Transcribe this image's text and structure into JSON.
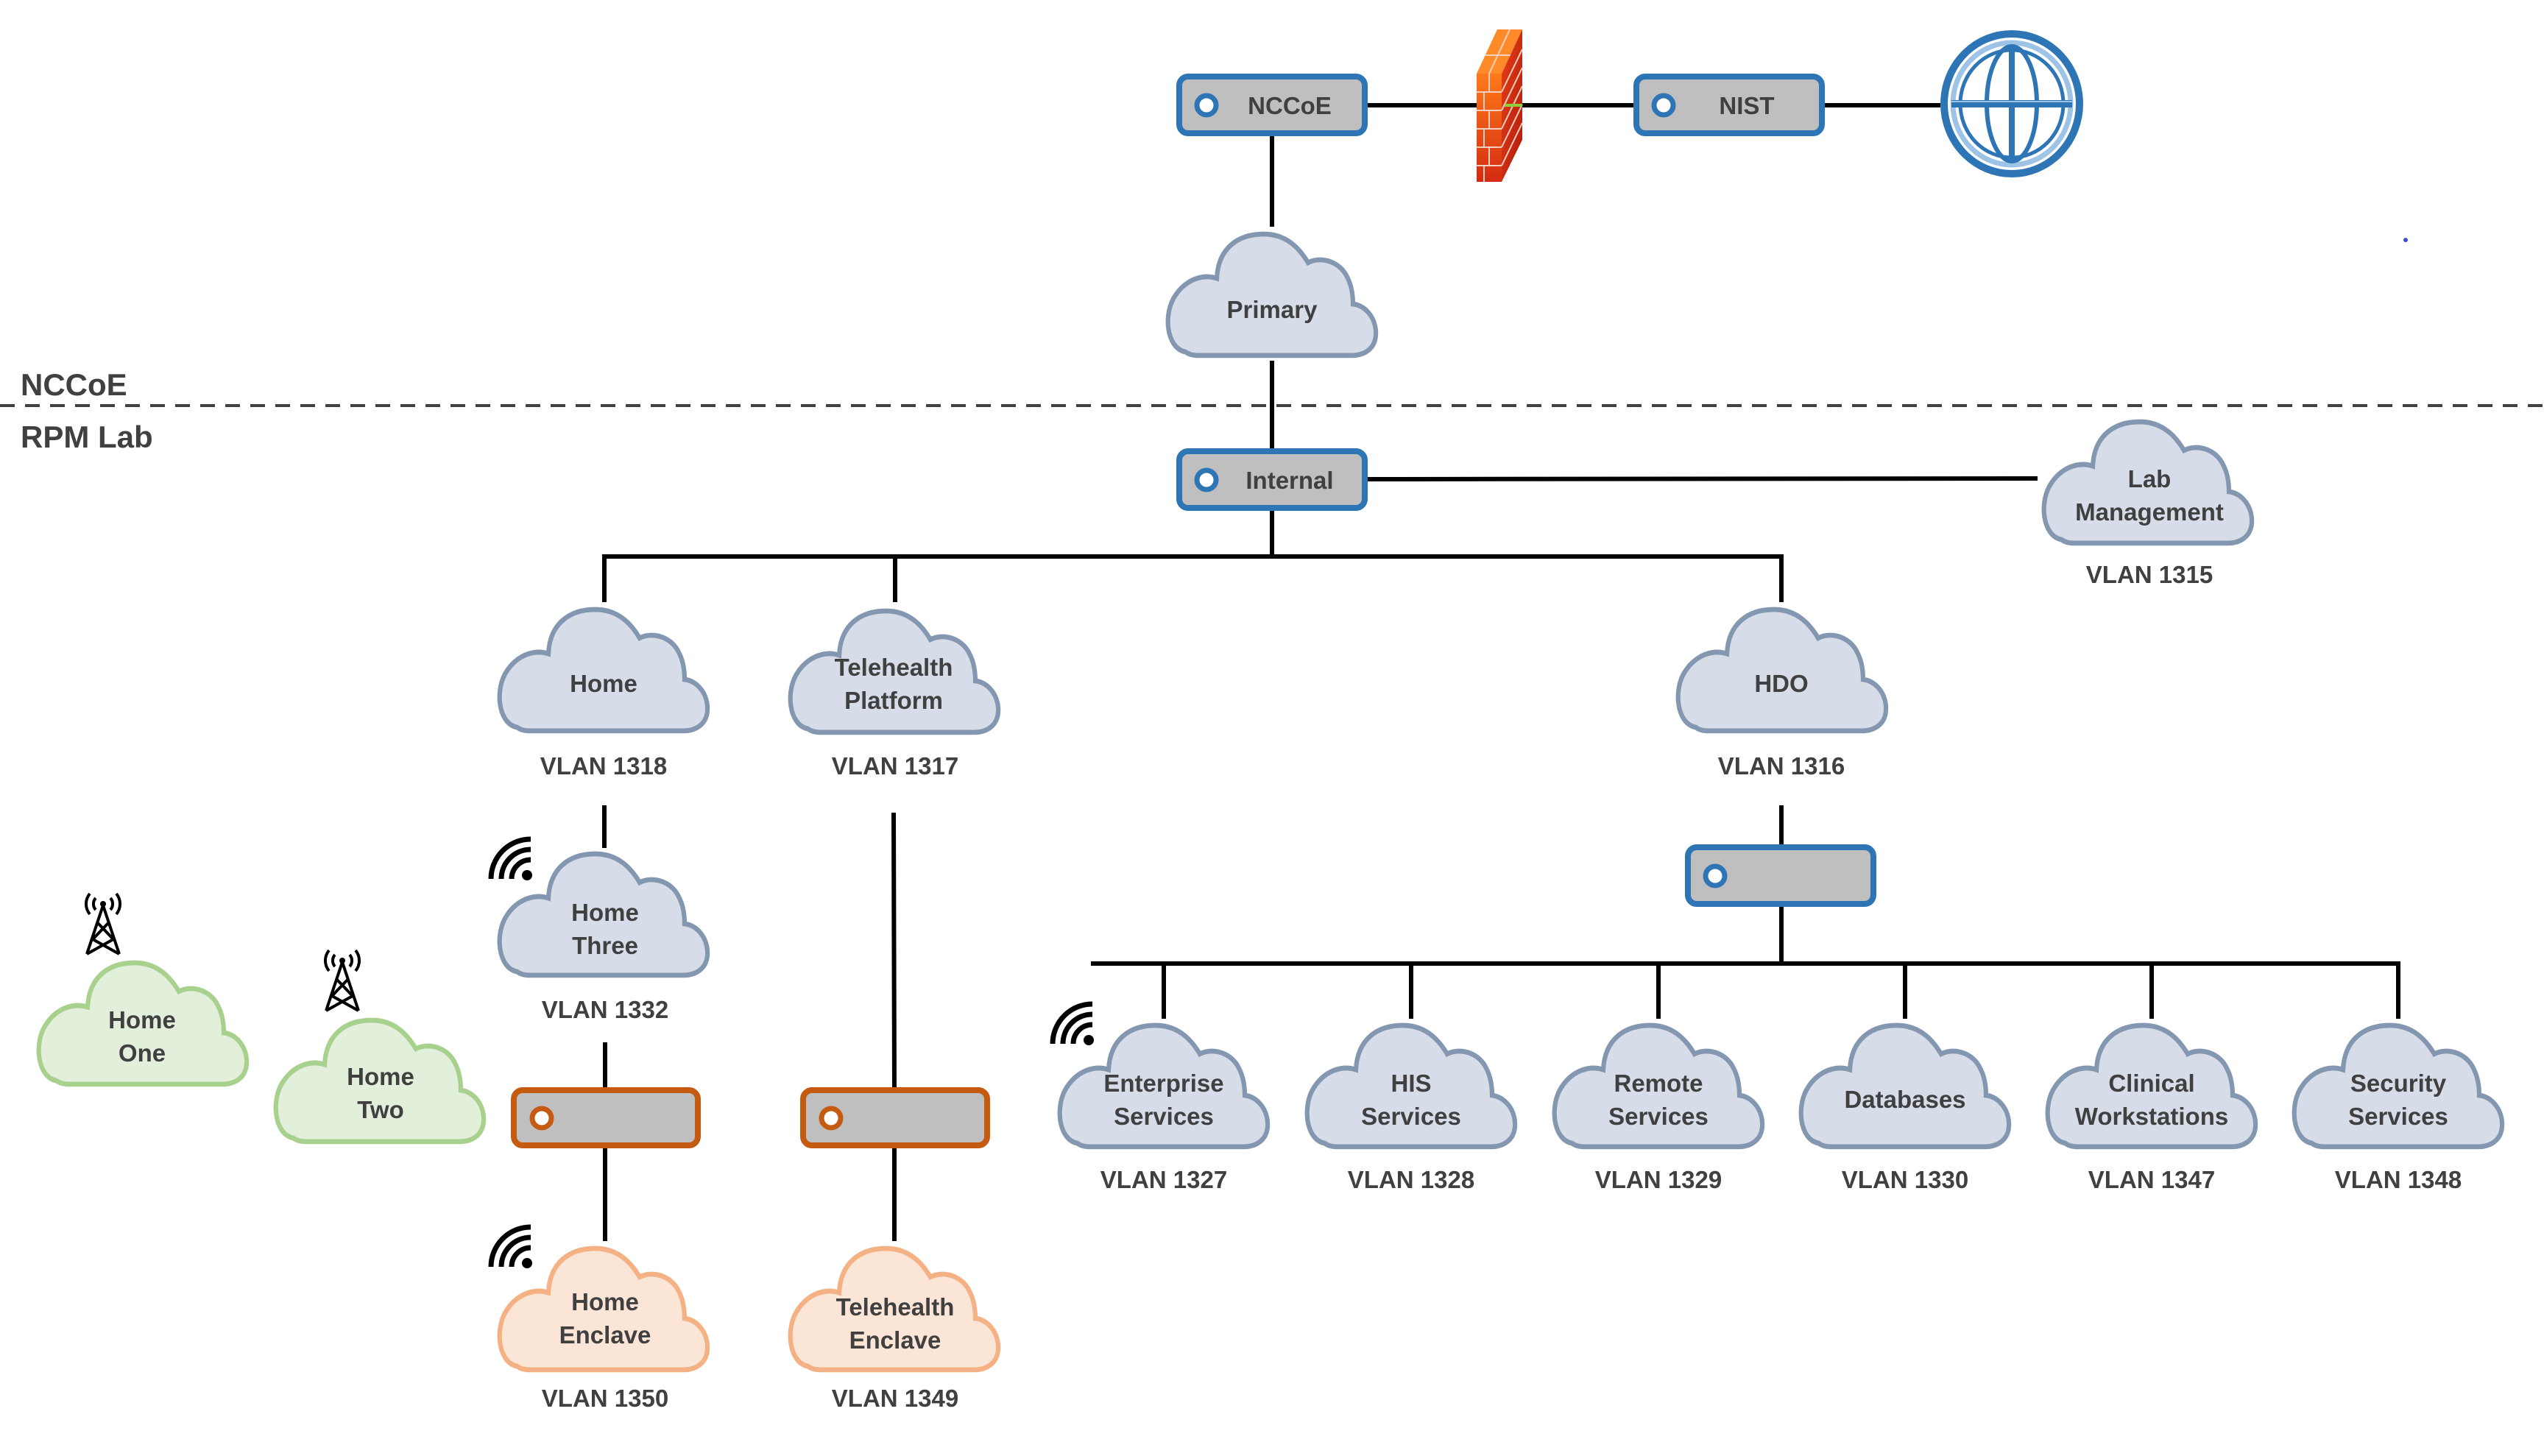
{
  "diagram": {
    "zones": {
      "upper_label": "NCCoE",
      "lower_label": "RPM Lab"
    },
    "colors": {
      "cloud_blue_fill": "#d6dde8",
      "cloud_blue_stroke": "#8497b0",
      "cloud_green_fill": "#e2efda",
      "cloud_green_stroke": "#a9d18e",
      "cloud_orange_fill": "#fbe5d6",
      "cloud_orange_stroke": "#f4b183",
      "router_fill": "#bfbfbf",
      "router_blue_stroke": "#2e75b6",
      "router_orange_stroke": "#c55a11",
      "line": "#000000",
      "text": "#404040",
      "globe": "#2e75b6",
      "globe_light": "#9dc3e6"
    },
    "top": {
      "nccoe_router": "NCCoE",
      "firewall": "firewall-icon",
      "nist_router": "NIST",
      "internet": "globe-icon",
      "primary_cloud": "Primary"
    },
    "internal_router": "Internal",
    "lab_management": {
      "line1": "Lab",
      "line2": "Management",
      "vlan": "VLAN 1315"
    },
    "home": {
      "label": "Home",
      "vlan": "VLAN 1318"
    },
    "telehealth_platform": {
      "line1": "Telehealth",
      "line2": "Platform",
      "vlan": "VLAN 1317"
    },
    "hdo": {
      "label": "HDO",
      "vlan": "VLAN 1316"
    },
    "home_three": {
      "line1": "Home",
      "line2": "Three",
      "vlan": "VLAN 1332",
      "icon": "wifi-icon"
    },
    "home_one": {
      "line1": "Home",
      "line2": "One",
      "icon": "cell-tower-icon"
    },
    "home_two": {
      "line1": "Home",
      "line2": "Two",
      "icon": "cell-tower-icon"
    },
    "home_enclave": {
      "line1": "Home",
      "line2": "Enclave",
      "vlan": "VLAN 1350",
      "icon": "wifi-icon"
    },
    "telehealth_enclave": {
      "line1": "Telehealth",
      "line2": "Enclave",
      "vlan": "VLAN 1349"
    },
    "hdo_subnets": [
      {
        "line1": "Enterprise",
        "line2": "Services",
        "vlan": "VLAN 1327",
        "wifi": true
      },
      {
        "line1": "HIS",
        "line2": "Services",
        "vlan": "VLAN 1328",
        "wifi": false
      },
      {
        "line1": "Remote",
        "line2": "Services",
        "vlan": "VLAN 1329",
        "wifi": false
      },
      {
        "line1": "Databases",
        "line2": "",
        "vlan": "VLAN 1330",
        "wifi": false
      },
      {
        "line1": "Clinical",
        "line2": "Workstations",
        "vlan": "VLAN 1347",
        "wifi": false
      },
      {
        "line1": "Security",
        "line2": "Services",
        "vlan": "VLAN 1348",
        "wifi": false
      }
    ]
  }
}
